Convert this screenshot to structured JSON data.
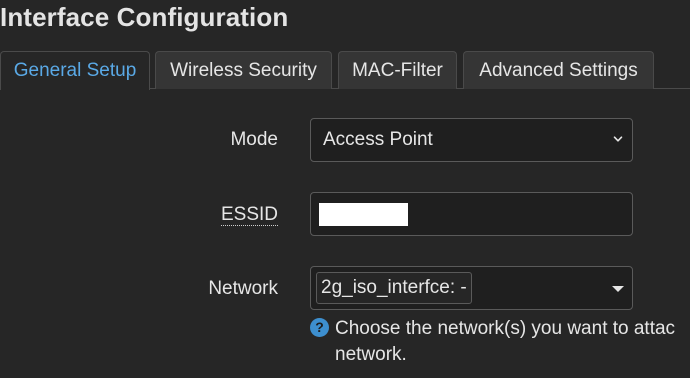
{
  "page": {
    "title": "Interface Configuration"
  },
  "tabs": [
    {
      "label": "General Setup",
      "active": true
    },
    {
      "label": "Wireless Security",
      "active": false
    },
    {
      "label": "MAC-Filter",
      "active": false
    },
    {
      "label": "Advanced Settings",
      "active": false
    }
  ],
  "form": {
    "mode": {
      "label": "Mode",
      "value": "Access Point"
    },
    "essid": {
      "label": "ESSID",
      "value": ""
    },
    "network": {
      "label": "Network",
      "value": "2g_iso_interfce: -",
      "help": "Choose the network(s) you want to attac network."
    }
  },
  "colors": {
    "background": "#262626",
    "accent": "#5aa9e6",
    "help_icon": "#3d8fcf"
  },
  "icons": {
    "mode_dropdown": "chevron-down-icon",
    "network_dropdown": "caret-down-icon",
    "help": "question-circle-icon"
  }
}
